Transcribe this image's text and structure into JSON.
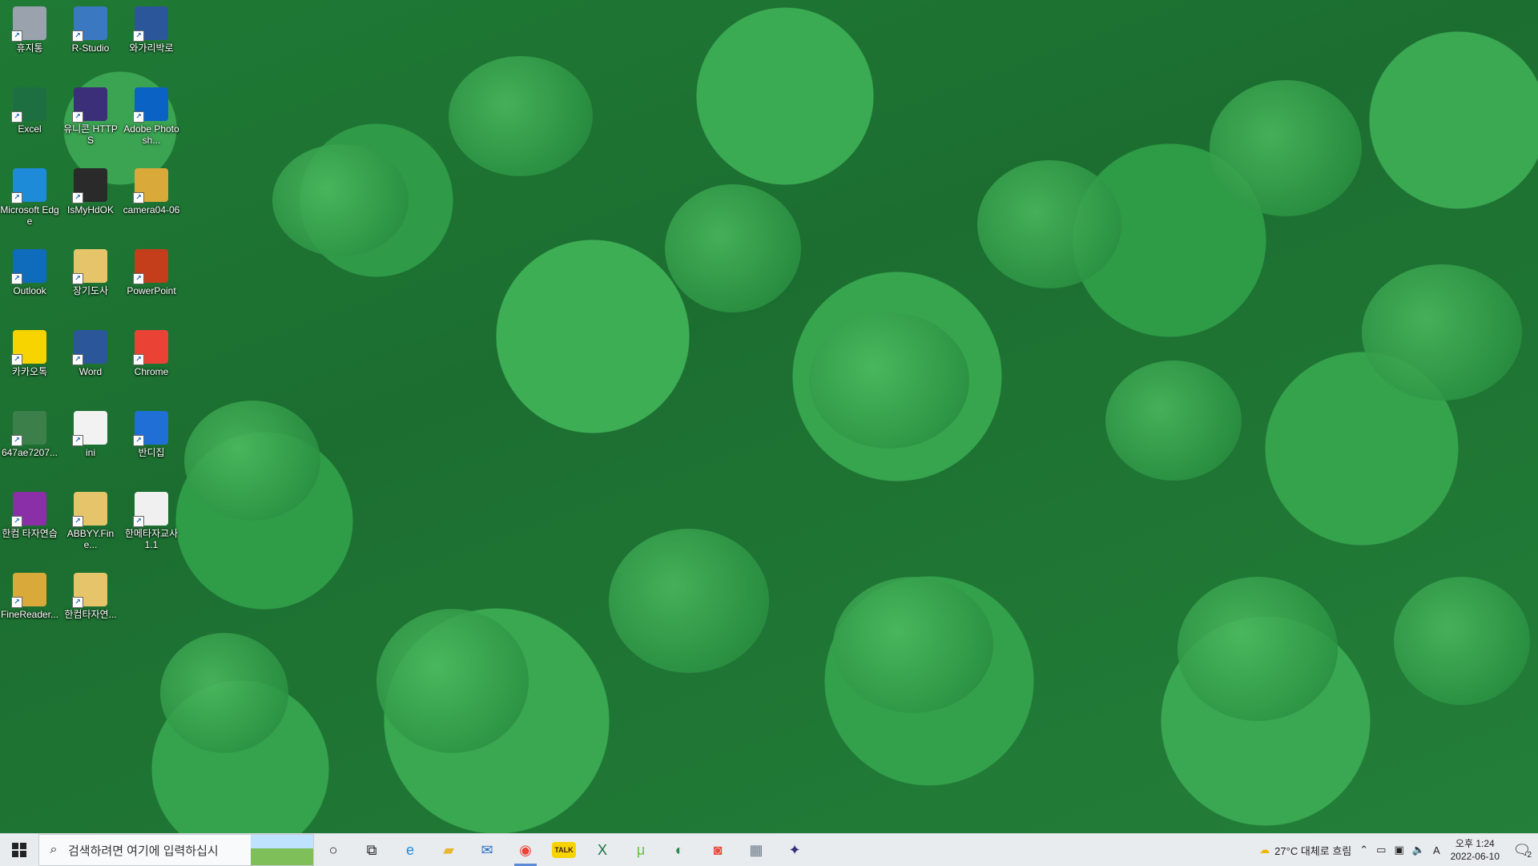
{
  "desktop_icons": [
    {
      "label": "휴지통",
      "icon": "recycle-bin-icon",
      "color": "#9aa3ad"
    },
    {
      "label": "R-Studio",
      "icon": "r-studio-icon",
      "color": "#3a78c2"
    },
    {
      "label": "와가리박로",
      "icon": "word-document-icon",
      "color": "#2b579a"
    },
    {
      "label": "Excel",
      "icon": "excel-icon",
      "color": "#1d6f42"
    },
    {
      "label": "유니콘 HTTPS",
      "icon": "unicorn-https-icon",
      "color": "#3b2f7a"
    },
    {
      "label": "Adobe Photosh...",
      "icon": "photoshop-icon",
      "color": "#0a63c4"
    },
    {
      "label": "Microsoft Edge",
      "icon": "edge-icon",
      "color": "#1d8bd8"
    },
    {
      "label": "IsMyHdOK",
      "icon": "ismyhdok-icon",
      "color": "#2a2a2a"
    },
    {
      "label": "camera04-06",
      "icon": "folder-icon",
      "color": "#d9a93a"
    },
    {
      "label": "Outlook",
      "icon": "outlook-icon",
      "color": "#0f6cbd"
    },
    {
      "label": "장기도사",
      "icon": "folder-icon",
      "color": "#e6c56a"
    },
    {
      "label": "PowerPoint",
      "icon": "powerpoint-icon",
      "color": "#c43e1c"
    },
    {
      "label": "카카오톡",
      "icon": "kakaotalk-icon",
      "color": "#f7d400"
    },
    {
      "label": "Word",
      "icon": "word-icon",
      "color": "#2b579a"
    },
    {
      "label": "Chrome",
      "icon": "chrome-icon",
      "color": "#ea4335"
    },
    {
      "label": "647ae7207...",
      "icon": "image-file-icon",
      "color": "#3d7f4a"
    },
    {
      "label": "ini",
      "icon": "text-file-icon",
      "color": "#f2f2f2"
    },
    {
      "label": "반디집",
      "icon": "bandizip-icon",
      "color": "#1f6fd6"
    },
    {
      "label": "한컴 타자연습",
      "icon": "hancom-typing-icon",
      "color": "#8a2fa8"
    },
    {
      "label": "ABBYY.Fine...",
      "icon": "folder-icon",
      "color": "#e6c56a"
    },
    {
      "label": "한메타자교사 1.1",
      "icon": "hanme-typing-icon",
      "color": "#f0f0f0"
    },
    {
      "label": "FineReader...",
      "icon": "folder-icon",
      "color": "#d9a93a"
    },
    {
      "label": "한컴타자연...",
      "icon": "folder-icon",
      "color": "#e6c56a"
    }
  ],
  "taskbar": {
    "search_placeholder": "검색하려면 여기에 입력하십시",
    "pinned": [
      {
        "name": "cortana-icon",
        "glyph": "○",
        "color": "#222"
      },
      {
        "name": "task-view-icon",
        "glyph": "⧉",
        "color": "#222"
      },
      {
        "name": "edge-icon",
        "glyph": "e",
        "color": "#1d8bd8"
      },
      {
        "name": "file-explorer-icon",
        "glyph": "▰",
        "color": "#e8b730"
      },
      {
        "name": "mail-icon",
        "glyph": "✉",
        "color": "#2a6fc8"
      },
      {
        "name": "chrome-icon",
        "glyph": "◉",
        "color": "#ea4335"
      },
      {
        "name": "kakaotalk-icon",
        "glyph": "TALK",
        "color": "#f7d400"
      },
      {
        "name": "excel-icon",
        "glyph": "X",
        "color": "#1d6f42"
      },
      {
        "name": "utorrent-icon",
        "glyph": "μ",
        "color": "#6bbf3b"
      },
      {
        "name": "globe-app-icon",
        "glyph": "◐",
        "color": "#2a8a4a"
      },
      {
        "name": "screen-recorder-icon",
        "glyph": "◙",
        "color": "#e84c3d"
      },
      {
        "name": "image-viewer-icon",
        "glyph": "▦",
        "color": "#6c7a89"
      },
      {
        "name": "unicorn-https-icon",
        "glyph": "✦",
        "color": "#3b2f7a"
      }
    ],
    "weather": "27°C  대체로 흐림",
    "ime": "A",
    "clock_time": "오후 1:24",
    "clock_date": "2022-06-10",
    "notification_count": "2"
  }
}
